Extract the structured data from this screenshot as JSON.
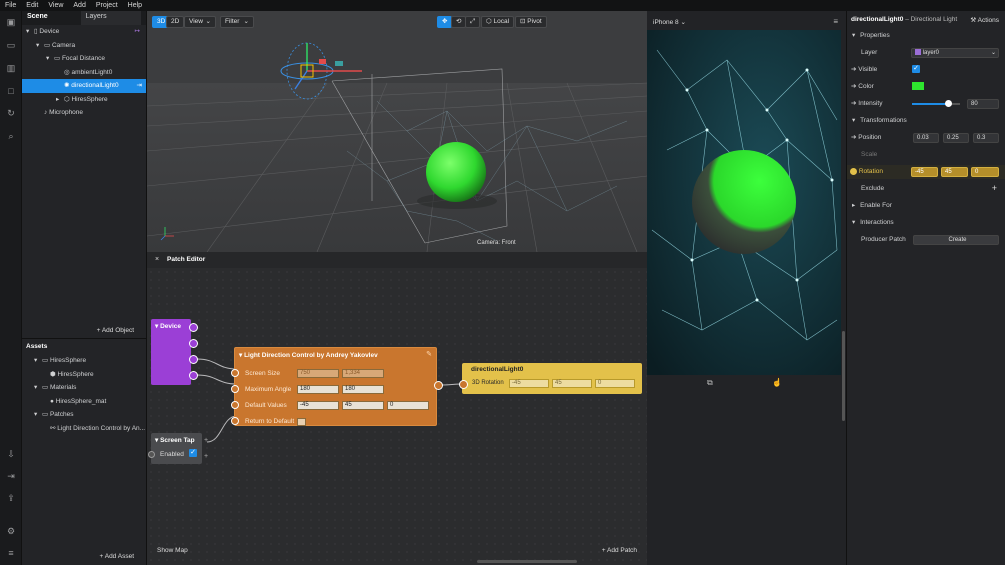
{
  "menu": [
    "File",
    "Edit",
    "View",
    "Add",
    "Project",
    "Help"
  ],
  "scene": {
    "tabs": [
      "Scene",
      "Layers"
    ],
    "tree": [
      {
        "label": "Device",
        "indent": 0
      },
      {
        "label": "Camera",
        "indent": 1
      },
      {
        "label": "Focal Distance",
        "indent": 2
      },
      {
        "label": "ambientLight0",
        "indent": 3
      },
      {
        "label": "directionalLight0",
        "indent": 3
      },
      {
        "label": "HiresSphere",
        "indent": 3
      },
      {
        "label": "Microphone",
        "indent": 1
      }
    ],
    "add_object": "+ Add Object"
  },
  "assets": {
    "title": "Assets",
    "items": [
      {
        "label": "HiresSphere",
        "indent": 1
      },
      {
        "label": "HiresSphere",
        "indent": 2
      },
      {
        "label": "Materials",
        "indent": 1
      },
      {
        "label": "HiresSphere_mat",
        "indent": 2
      },
      {
        "label": "Patches",
        "indent": 1
      },
      {
        "label": "Light Direction Control by An...",
        "indent": 2
      }
    ],
    "add_asset": "+ Add Asset"
  },
  "viewport": {
    "btn_3d": "3D",
    "btn_2d": "2D",
    "view": "View",
    "filter": "Filter",
    "local": "Local",
    "pivot": "Pivot",
    "camera_label": "Camera: Front"
  },
  "patch": {
    "title": "Patch Editor",
    "device": "Device",
    "ldc_title": "Light Direction Control by Andrey Yakovlev",
    "ldc_rows": [
      {
        "label": "Screen Size",
        "v1": "750",
        "v2": "1,334"
      },
      {
        "label": "Maximum Angle",
        "v1": "180",
        "v2": "180"
      },
      {
        "label": "Default Values",
        "v1": "-45",
        "v2": "45",
        "v3": "0"
      },
      {
        "label": "Return to Default"
      }
    ],
    "dl_title": "directionalLight0",
    "dl_row": "3D Rotation",
    "dl_vals": [
      "-45",
      "45",
      "0"
    ],
    "screen_tap": "Screen Tap",
    "enabled": "Enabled",
    "show_map": "Show Map",
    "add_patch": "+ Add Patch"
  },
  "preview": {
    "device": "iPhone 8"
  },
  "inspector": {
    "object": "directionalLight0",
    "type": "– Directional Light",
    "actions": "Actions",
    "properties": "Properties",
    "layer_label": "Layer",
    "layer_value": "layer0",
    "visible": "Visible",
    "color": "Color",
    "intensity": "Intensity",
    "intensity_value": "80",
    "transformations": "Transformations",
    "position": "Position",
    "pos": [
      "0.03",
      "0.25",
      "0.3"
    ],
    "scale": "Scale",
    "rotation": "Rotation",
    "rot": [
      "-45",
      "45",
      "0"
    ],
    "exclude": "Exclude",
    "enable_for": "Enable For",
    "interactions": "Interactions",
    "producer": "Producer Patch",
    "create": "Create"
  },
  "colors": {
    "accent": "#1e8ce6",
    "device_node": "#9b3fd6",
    "ldc_node": "#c9762e",
    "dl_node": "#e3c14a",
    "light_color": "#2ee62e"
  }
}
